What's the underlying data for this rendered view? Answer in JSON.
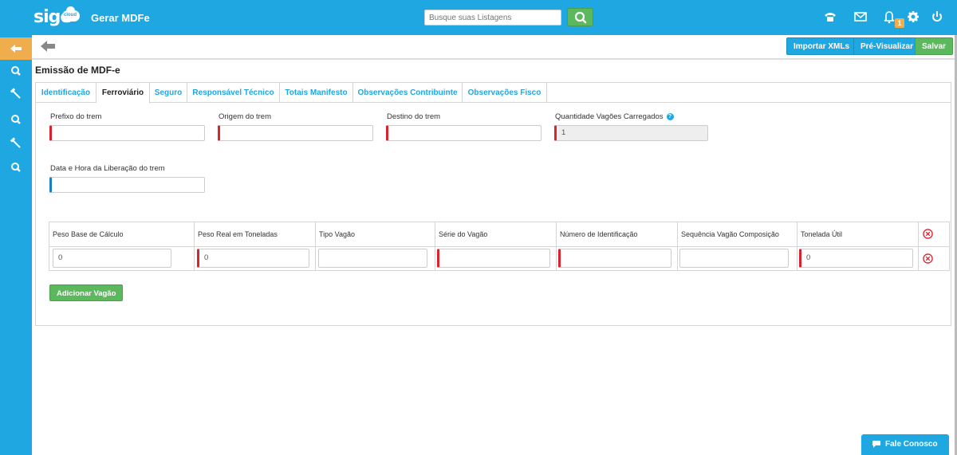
{
  "header": {
    "logo": "sige",
    "logo_sub": "cloud",
    "app_title": "Gerar MDFe",
    "search_placeholder": "Busque suas Listagens",
    "notification_count": "1",
    "icons": [
      "phone-icon",
      "mail-icon",
      "bell-icon",
      "gear-icon",
      "power-icon"
    ]
  },
  "sidebar": {
    "items": [
      "back-arrow-icon",
      "search-icon",
      "hammer-icon",
      "search-icon",
      "hammer-icon",
      "search-icon"
    ]
  },
  "toolbar": {
    "import_label": "Importar XMLs",
    "preview_label": "Pré-Visualizar",
    "save_label": "Salvar"
  },
  "page": {
    "title": "Emissão de MDF-e"
  },
  "tabs": [
    {
      "label": "Identificação",
      "active": false
    },
    {
      "label": "Ferroviário",
      "active": true
    },
    {
      "label": "Seguro",
      "active": false
    },
    {
      "label": "Responsável Técnico",
      "active": false
    },
    {
      "label": "Totais Manifesto",
      "active": false
    },
    {
      "label": "Observações Contribuinte",
      "active": false
    },
    {
      "label": "Observações Fisco",
      "active": false
    }
  ],
  "form": {
    "prefixo_label": "Prefixo do trem",
    "prefixo_value": "",
    "origem_label": "Origem do trem",
    "origem_value": "",
    "destino_label": "Destino do trem",
    "destino_value": "",
    "quantidade_label": "Quantidade Vagões Carregados",
    "quantidade_value": "1",
    "data_label": "Data e Hora da Liberação do trem",
    "data_value": ""
  },
  "wagons": {
    "columns": [
      "Peso Base de Cálculo",
      "Peso Real em Toneladas",
      "Tipo Vagão",
      "Série do Vagão",
      "Número de Identificação",
      "Sequência Vagão Composição",
      "Tonelada Útil"
    ],
    "rows": [
      [
        "0",
        "0",
        "",
        "",
        "",
        "",
        "0"
      ]
    ],
    "add_label": "Adicionar Vagão"
  },
  "chat": {
    "label": "Fale Conosco"
  },
  "colors": {
    "primary": "#1ea7e1",
    "success": "#5cb85c",
    "warning": "#f0ad4e",
    "required": "#d9242f"
  }
}
